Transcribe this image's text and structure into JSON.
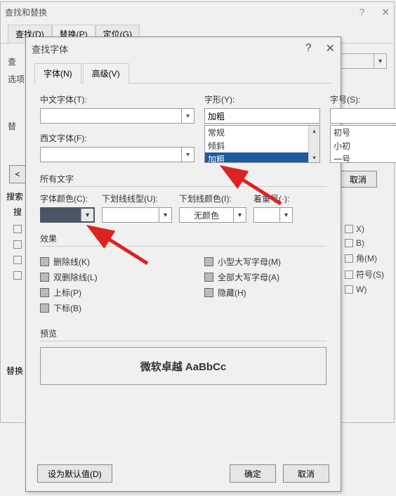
{
  "outer": {
    "title": "查找和替换",
    "tabs": {
      "find": "查找(D)",
      "replace": "替换(P)",
      "goto": "定位(G)"
    },
    "labels": {
      "find": "查",
      "options": "选项",
      "replace": "替",
      "lt": "<",
      "search": "搜索",
      "sub": "搜",
      "repl2": "替换"
    },
    "cancel": "取消",
    "rightOpts": {
      "x": "X)",
      "b": "B)",
      "corner": "角(M)",
      "suffix": "符号(S)",
      "w": "W)"
    }
  },
  "font": {
    "title": "查找字体",
    "tabs": {
      "font": "字体(N)",
      "advanced": "高级(V)"
    },
    "labels": {
      "cnFont": "中文字体(T):",
      "enFont": "西文字体(F):",
      "style": "字形(Y):",
      "size": "字号(S):",
      "allText": "所有文字",
      "fontColor": "字体颜色(C):",
      "underlineType": "下划线线型(U):",
      "underlineColor": "下划线颜色(I):",
      "emphasis": "着重号(·):",
      "effects": "效果",
      "preview": "预览"
    },
    "styleValue": "加粗",
    "styleList": [
      "常规",
      "倾斜",
      "加粗"
    ],
    "sizeList": [
      "初号",
      "小初",
      "一号"
    ],
    "underlineColorValue": "无颜色",
    "effects": {
      "left": [
        "删除线(K)",
        "双删除线(L)",
        "上标(P)",
        "下标(B)"
      ],
      "right": [
        "小型大写字母(M)",
        "全部大写字母(A)",
        "隐藏(H)"
      ]
    },
    "previewText": "微软卓越  AaBbCc",
    "buttons": {
      "default": "设为默认值(D)",
      "ok": "确定",
      "cancel": "取消"
    }
  }
}
